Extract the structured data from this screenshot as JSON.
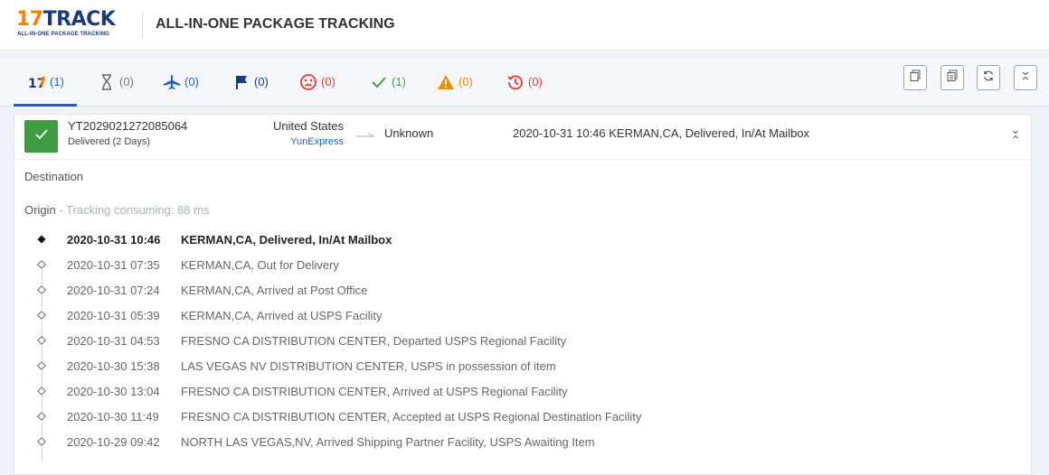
{
  "header": {
    "logo_main_17": "17",
    "logo_main_rest": "TRACK",
    "logo_sub": "ALL-IN-ONE PACKAGE TRACKING",
    "title": "ALL-IN-ONE PACKAGE TRACKING"
  },
  "tabs": [
    {
      "icon": "17track-icon",
      "count": "(1)",
      "color": "#1a62c8"
    },
    {
      "icon": "hourglass-icon",
      "count": "(0)",
      "color": "#777777"
    },
    {
      "icon": "airplane-icon",
      "count": "(0)",
      "color": "#1a62c8"
    },
    {
      "icon": "flag-icon",
      "count": "(0)",
      "color": "#1b3a7b"
    },
    {
      "icon": "sad-face-icon",
      "count": "(0)",
      "color": "#e53935"
    },
    {
      "icon": "checkmark-icon",
      "count": "(1)",
      "color": "#43a047"
    },
    {
      "icon": "warning-icon",
      "count": "(0)",
      "color": "#f08c00"
    },
    {
      "icon": "expired-icon",
      "count": "(0)",
      "color": "#e53935"
    }
  ],
  "toolbar": [
    {
      "icon": "copy-icon"
    },
    {
      "icon": "copy-all-icon"
    },
    {
      "icon": "refresh-icon"
    },
    {
      "icon": "collapse-all-icon"
    }
  ],
  "shipment": {
    "tracking_number": "YT2029021272085064",
    "status": "Delivered (2 Days)",
    "origin_country": "United States",
    "carrier": "YunExpress",
    "destination_country": "Unknown",
    "latest_event": "2020-10-31 10:46  KERMAN,CA, Delivered, In/At Mailbox"
  },
  "detail": {
    "destination_label": "Destination",
    "origin_label": "Origin",
    "origin_note": " - Tracking consuming: 88 ms"
  },
  "events": [
    {
      "time": "2020-10-31 10:46",
      "desc": "KERMAN,CA, Delivered, In/At Mailbox"
    },
    {
      "time": "2020-10-31 07:35",
      "desc": "KERMAN,CA, Out for Delivery"
    },
    {
      "time": "2020-10-31 07:24",
      "desc": "KERMAN,CA, Arrived at Post Office"
    },
    {
      "time": "2020-10-31 05:39",
      "desc": "KERMAN,CA, Arrived at USPS Facility"
    },
    {
      "time": "2020-10-31 04:53",
      "desc": "FRESNO CA DISTRIBUTION CENTER, Departed USPS Regional Facility"
    },
    {
      "time": "2020-10-30 15:38",
      "desc": "LAS VEGAS NV DISTRIBUTION CENTER, USPS in possession of item"
    },
    {
      "time": "2020-10-30 13:04",
      "desc": "FRESNO CA DISTRIBUTION CENTER, Arrived at USPS Regional Facility"
    },
    {
      "time": "2020-10-30 11:49",
      "desc": "FRESNO CA DISTRIBUTION CENTER, Accepted at USPS Regional Destination Facility"
    },
    {
      "time": "2020-10-29 09:42",
      "desc": "NORTH LAS VEGAS,NV, Arrived Shipping Partner Facility, USPS Awaiting Item"
    }
  ]
}
